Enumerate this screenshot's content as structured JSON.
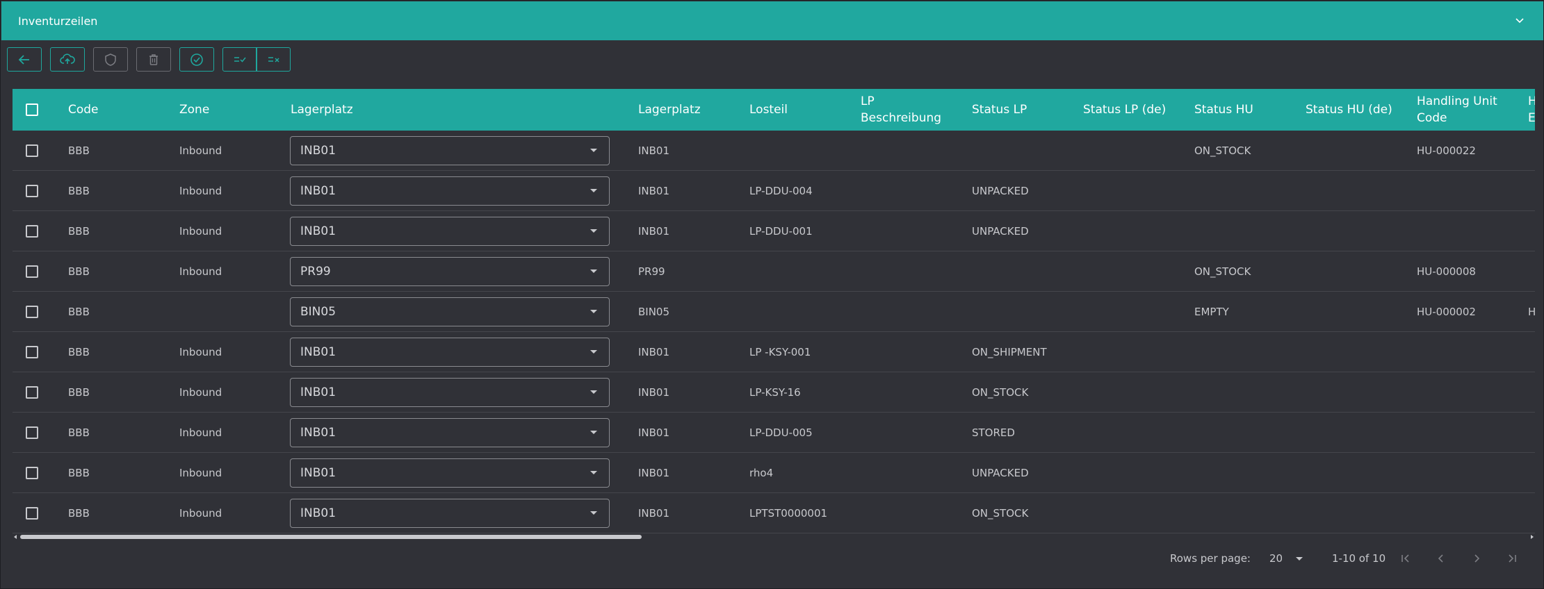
{
  "header": {
    "title": "Inventurzeilen",
    "collapse_icon": "chevron-down-icon"
  },
  "toolbar": {
    "buttons": [
      {
        "name": "back-button",
        "icon": "arrow-left-icon"
      },
      {
        "name": "upload-button",
        "icon": "cloud-upload-icon"
      },
      {
        "name": "shield-button",
        "icon": "shield-icon"
      },
      {
        "name": "delete-button",
        "icon": "trash-icon"
      },
      {
        "name": "confirm-button",
        "icon": "check-circle-icon"
      },
      {
        "name": "select-all-button",
        "icon": "list-check-icon"
      },
      {
        "name": "deselect-all-button",
        "icon": "list-x-icon"
      }
    ]
  },
  "table": {
    "columns": {
      "code": "Code",
      "zone": "Zone",
      "lagerplatz_select": "Lagerplatz",
      "lagerplatz": "Lagerplatz",
      "losteil": "Losteil",
      "lp_beschreibung_1": "LP",
      "lp_beschreibung_2": "Beschreibung",
      "status_lp": "Status LP",
      "status_lp_de": "Status LP (de)",
      "status_hu": "Status HU",
      "status_hu_de": "Status HU (de)",
      "hu_code_1": "Handling Unit",
      "hu_code_2": "Code",
      "next_1": "H",
      "next_2": "E"
    },
    "rows": [
      {
        "code": "BBB",
        "zone": "Inbound",
        "select": "INB01",
        "lagerplatz": "INB01",
        "losteil": "",
        "status_lp": "",
        "status_hu": "ON_STOCK",
        "hu_code": "HU-000022",
        "next": ""
      },
      {
        "code": "BBB",
        "zone": "Inbound",
        "select": "INB01",
        "lagerplatz": "INB01",
        "losteil": "LP-DDU-004",
        "status_lp": "UNPACKED",
        "status_hu": "",
        "hu_code": "",
        "next": ""
      },
      {
        "code": "BBB",
        "zone": "Inbound",
        "select": "INB01",
        "lagerplatz": "INB01",
        "losteil": "LP-DDU-001",
        "status_lp": "UNPACKED",
        "status_hu": "",
        "hu_code": "",
        "next": ""
      },
      {
        "code": "BBB",
        "zone": "Inbound",
        "select": "PR99",
        "lagerplatz": "PR99",
        "losteil": "",
        "status_lp": "",
        "status_hu": "ON_STOCK",
        "hu_code": "HU-000008",
        "next": ""
      },
      {
        "code": "BBB",
        "zone": "",
        "select": "BIN05",
        "lagerplatz": "BIN05",
        "losteil": "",
        "status_lp": "",
        "status_hu": "EMPTY",
        "hu_code": "HU-000002",
        "next": "H"
      },
      {
        "code": "BBB",
        "zone": "Inbound",
        "select": "INB01",
        "lagerplatz": "INB01",
        "losteil": "LP -KSY-001",
        "status_lp": "ON_SHIPMENT",
        "status_hu": "",
        "hu_code": "",
        "next": ""
      },
      {
        "code": "BBB",
        "zone": "Inbound",
        "select": "INB01",
        "lagerplatz": "INB01",
        "losteil": "LP-KSY-16",
        "status_lp": "ON_STOCK",
        "status_hu": "",
        "hu_code": "",
        "next": ""
      },
      {
        "code": "BBB",
        "zone": "Inbound",
        "select": "INB01",
        "lagerplatz": "INB01",
        "losteil": "LP-DDU-005",
        "status_lp": "STORED",
        "status_hu": "",
        "hu_code": "",
        "next": ""
      },
      {
        "code": "BBB",
        "zone": "Inbound",
        "select": "INB01",
        "lagerplatz": "INB01",
        "losteil": "rho4",
        "status_lp": "UNPACKED",
        "status_hu": "",
        "hu_code": "",
        "next": ""
      },
      {
        "code": "BBB",
        "zone": "Inbound",
        "select": "INB01",
        "lagerplatz": "INB01",
        "losteil": "LPTST0000001",
        "status_lp": "ON_STOCK",
        "status_hu": "",
        "hu_code": "",
        "next": ""
      }
    ]
  },
  "pagination": {
    "rows_per_page_label": "Rows per page:",
    "rows_per_page_value": "20",
    "range": "1-10 of 10"
  },
  "colors": {
    "accent": "#20a89f",
    "background": "#303137"
  }
}
